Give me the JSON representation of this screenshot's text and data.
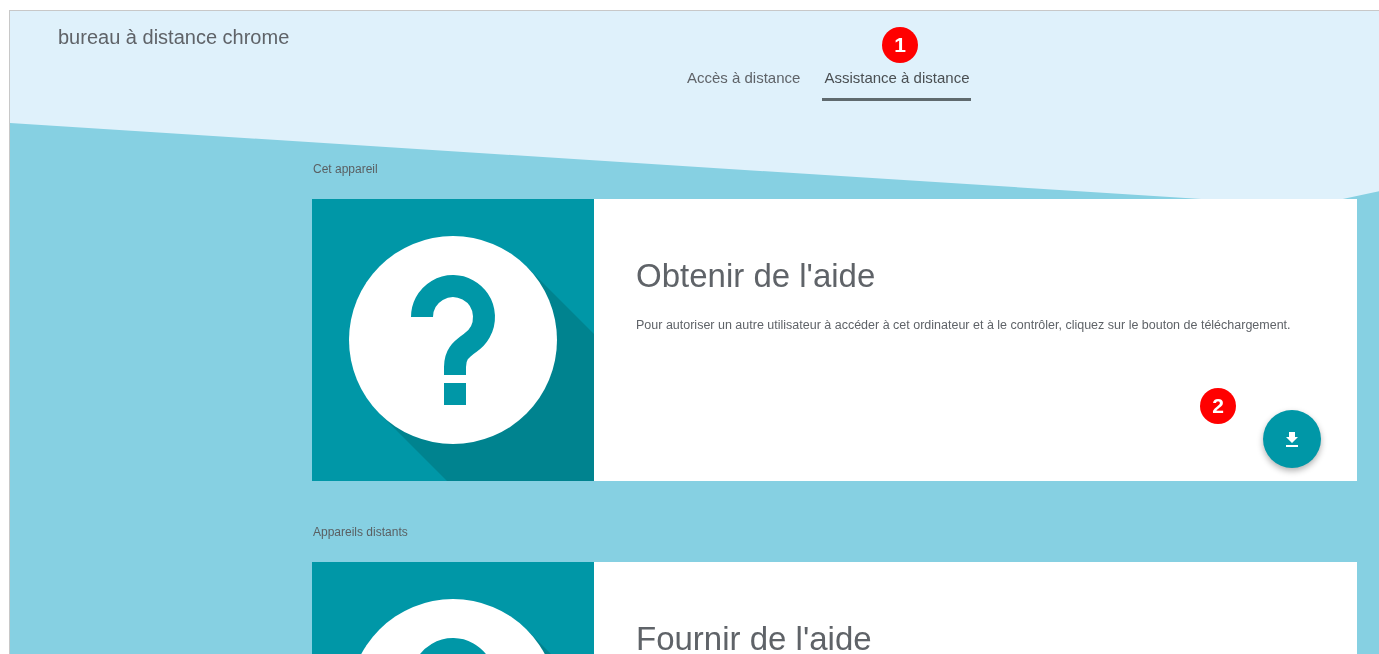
{
  "app_title": "bureau à distance chrome",
  "tabs": [
    {
      "label": "Accès à distance",
      "selected": false
    },
    {
      "label": "Assistance à distance",
      "selected": true
    }
  ],
  "sections": [
    {
      "label": "Cet appareil",
      "card": {
        "title": "Obtenir de l'aide",
        "description": "Pour autoriser un autre utilisateur à accéder à cet ordinateur et à le contrôler, cliquez sur le bouton de téléchargement.",
        "fab": {
          "kind": "download"
        }
      }
    },
    {
      "label": "Appareils distants",
      "card": {
        "title": "Fournir de l'aide"
      }
    }
  ],
  "annotations": [
    {
      "text": "1"
    },
    {
      "text": "2"
    }
  ]
}
